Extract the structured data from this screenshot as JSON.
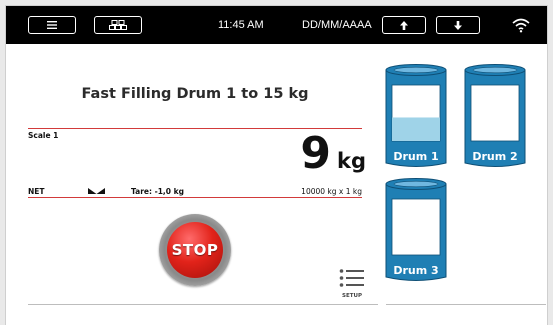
{
  "topbar": {
    "time": "11:45 AM",
    "date_format": "DD/MM/AAAA",
    "menu_icon": "hamburger-icon",
    "grid_icon": "grid-icon",
    "up_icon": "arrow-up-icon",
    "down_icon": "arrow-down-icon",
    "wifi_icon": "wifi-icon"
  },
  "main": {
    "title": "Fast Filling Drum 1 to 15 kg",
    "scale_label": "Scale 1",
    "weight_value": "9",
    "weight_unit": "kg",
    "net_label": "NET",
    "tare_label": "Tare: -1,0 kg",
    "capacity": "10000 kg x 1 kg",
    "stop_label": "STOP",
    "setup_label": "SETUP"
  },
  "drums": [
    {
      "label": "Drum 1",
      "fill_fraction": 0.42,
      "selected": true
    },
    {
      "label": "Drum 2",
      "fill_fraction": 0,
      "selected": false
    },
    {
      "label": "Drum 3",
      "fill_fraction": 0,
      "selected": false
    }
  ],
  "colors": {
    "drum_body": "#1f7fb4",
    "drum_fill": "#9fd3e8",
    "drum_stripe": "#6fb7e0",
    "accent_red": "#d23a3a",
    "stop_red": "#e2231a"
  }
}
